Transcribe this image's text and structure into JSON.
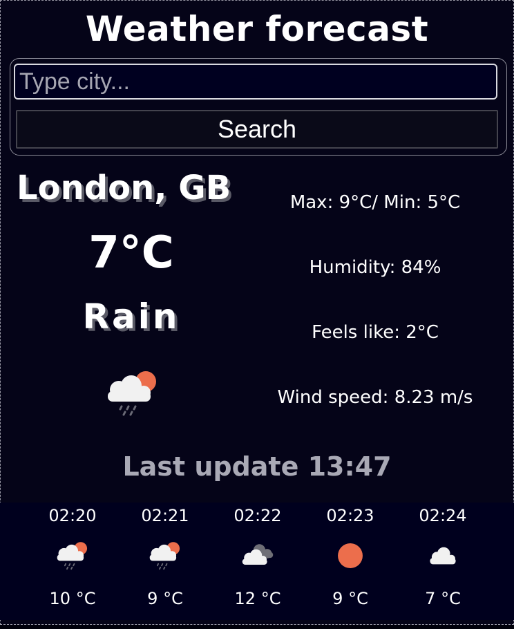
{
  "header": {
    "title": "Weather forecast"
  },
  "search": {
    "placeholder": "Type city...",
    "value": "",
    "button_label": "Search"
  },
  "current": {
    "city": "London, GB",
    "temperature": "7°C",
    "condition": "Rain",
    "icon": "rain-cloud-sun-icon",
    "max_min": "Max: 9°C/ Min: 5°C",
    "humidity": "Humidity: 84%",
    "feels_like": "Feels like: 2°C",
    "wind_speed": "Wind speed: 8.23 m/s",
    "last_update": "Last update 13:47"
  },
  "forecast": [
    {
      "time": "02:20",
      "temp": "10 °C",
      "icon": "rain-cloud-sun-icon"
    },
    {
      "time": "02:21",
      "temp": "9 °C",
      "icon": "rain-cloud-sun-icon"
    },
    {
      "time": "02:22",
      "temp": "12 °C",
      "icon": "dark-clouds-icon"
    },
    {
      "time": "02:23",
      "temp": "9 °C",
      "icon": "sun-icon"
    },
    {
      "time": "02:24",
      "temp": "7 °C",
      "icon": "cloud-icon"
    }
  ],
  "colors": {
    "background": "#050418",
    "forecast_background": "#00001e",
    "sun": "#ec6e4c",
    "cloud": "#f1f1f1",
    "muted_text": "#a9a9b5"
  }
}
